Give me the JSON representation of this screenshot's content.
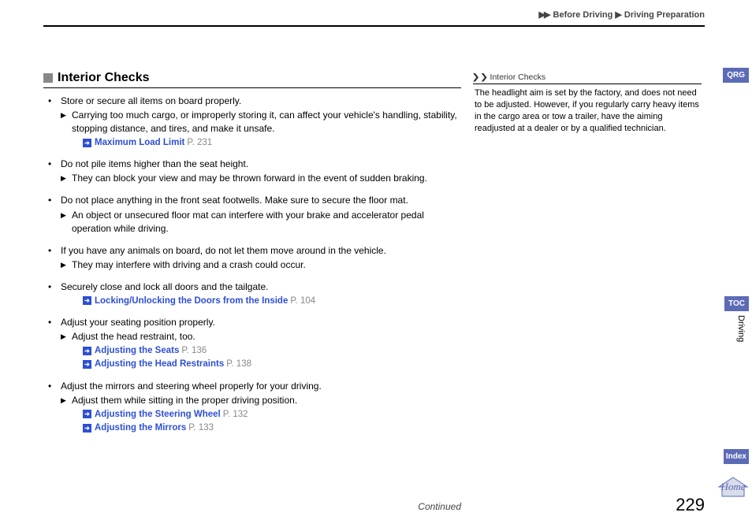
{
  "breadcrumb": {
    "a": "Before Driving",
    "b": "Driving Preparation"
  },
  "section": {
    "title": "Interior Checks"
  },
  "bullets": [
    {
      "text": "Store or secure all items on board properly.",
      "sub": "Carrying too much cargo, or improperly storing it, can affect your vehicle's handling, stability, stopping distance, and tires, and make it unsafe.",
      "refs": [
        {
          "t": "Maximum Load Limit",
          "p": "P. 231"
        }
      ]
    },
    {
      "text": "Do not pile items higher than the seat height.",
      "sub": "They can block your view and may be thrown forward in the event of sudden braking."
    },
    {
      "text": "Do not place anything in the front seat footwells. Make sure to secure the floor mat.",
      "sub": "An object or unsecured floor mat can interfere with your brake and accelerator pedal operation while driving."
    },
    {
      "text": "If you have any animals on board, do not let them move around in the vehicle.",
      "sub": "They may interfere with driving and a crash could occur."
    },
    {
      "text": "Securely close and lock all doors and the tailgate.",
      "refs": [
        {
          "t": "Locking/Unlocking the Doors from the Inside",
          "p": "P. 104"
        }
      ]
    },
    {
      "text": "Adjust your seating position properly.",
      "sub": "Adjust the head restraint, too.",
      "refs": [
        {
          "t": "Adjusting the Seats",
          "p": "P. 136"
        },
        {
          "t": "Adjusting the Head Restraints",
          "p": "P. 138"
        }
      ]
    },
    {
      "text": "Adjust the mirrors and steering wheel properly for your driving.",
      "sub": "Adjust them while sitting in the proper driving position.",
      "refs": [
        {
          "t": "Adjusting the Steering Wheel",
          "p": "P. 132"
        },
        {
          "t": "Adjusting the Mirrors",
          "p": "P. 133"
        }
      ]
    }
  ],
  "sidebar": {
    "title": "Interior Checks",
    "text": "The headlight aim is set by the factory, and does not need to be adjusted. However, if you regularly carry heavy items in the cargo area or tow a trailer, have the aiming readjusted at a dealer or by a qualified technician."
  },
  "footer": {
    "continued": "Continued",
    "page": "229"
  },
  "tabs": {
    "qrg": "QRG",
    "toc": "TOC",
    "chapter": "Driving",
    "index": "Index",
    "home": "Home"
  }
}
